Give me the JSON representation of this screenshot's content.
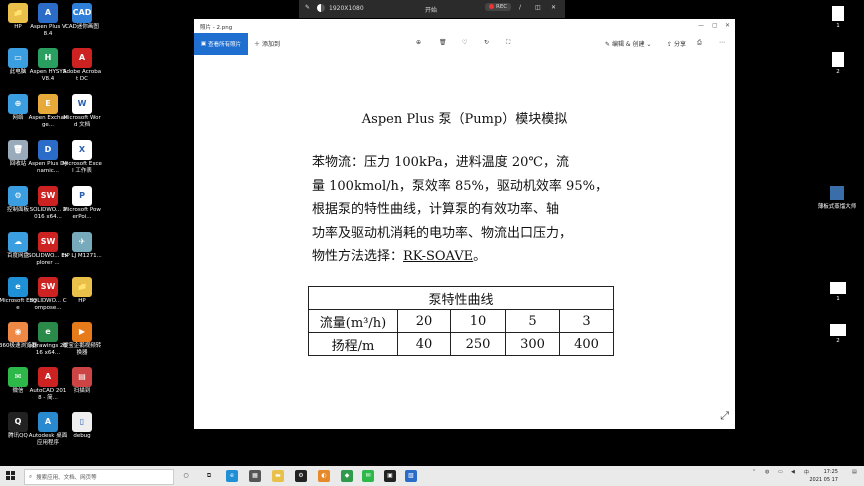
{
  "desktop_icons": [
    {
      "label": "HP",
      "glyph": "📁",
      "color": "#e8c04a",
      "icon": "folder-icon"
    },
    {
      "label": "Aspen Plus V8.4",
      "glyph": "A",
      "color": "#2a6cc8",
      "icon": "aspen-plus-icon"
    },
    {
      "label": "CAD迷你画图",
      "glyph": "CAD",
      "color": "#2f7fd8",
      "icon": "cad-icon"
    },
    {
      "label": "此电脑",
      "glyph": "▭",
      "color": "#3b9ee0",
      "icon": "computer-icon"
    },
    {
      "label": "Aspen HYSYS V8.4",
      "glyph": "H",
      "color": "#2aa060",
      "icon": "hysys-icon"
    },
    {
      "label": "Adobe Acrobat DC",
      "glyph": "A",
      "color": "#c22",
      "icon": "acrobat-icon"
    },
    {
      "label": "网络",
      "glyph": "⊕",
      "color": "#3b9ee0",
      "icon": "network-icon"
    },
    {
      "label": "Aspen Exchange...",
      "glyph": "E",
      "color": "#e6a93a",
      "icon": "aspen-exchanger-icon"
    },
    {
      "label": "Microsoft Word 文档",
      "glyph": "W",
      "color": "#fff",
      "icon": "word-doc-icon"
    },
    {
      "label": "回收站",
      "glyph": "🗑",
      "color": "#9ab",
      "icon": "recycle-bin-icon"
    },
    {
      "label": "Aspen Plus Dynamic...",
      "glyph": "D",
      "color": "#2a6cc8",
      "icon": "aspen-dynamics-icon"
    },
    {
      "label": "Microsoft Excel 工作表",
      "glyph": "X",
      "color": "#fff",
      "icon": "excel-doc-icon"
    },
    {
      "label": "控制面板",
      "glyph": "⚙",
      "color": "#3b9ee0",
      "icon": "control-panel-icon"
    },
    {
      "label": "SOLIDWO... 2016 x64...",
      "glyph": "SW",
      "color": "#c22",
      "icon": "solidworks-icon"
    },
    {
      "label": "Microsoft PowerPoi...",
      "glyph": "P",
      "color": "#fff",
      "icon": "powerpoint-doc-icon"
    },
    {
      "label": "百度网盘",
      "glyph": "☁",
      "color": "#3b9ee0",
      "icon": "baidu-netdisk-icon"
    },
    {
      "label": "SOLIDWO... Explorer ...",
      "glyph": "SW",
      "color": "#c22",
      "icon": "solidworks-explorer-icon"
    },
    {
      "label": "HP LJ M1271...",
      "glyph": "✈",
      "color": "#7ab",
      "icon": "printer-icon"
    },
    {
      "label": "Microsoft Edge",
      "glyph": "e",
      "color": "#1f8fd6",
      "icon": "edge-icon"
    },
    {
      "label": "SOLIDWO... Compose...",
      "glyph": "SW",
      "color": "#c22",
      "icon": "solidworks-composer-icon"
    },
    {
      "label": "HP",
      "glyph": "📁",
      "color": "#e8c04a",
      "icon": "folder-icon"
    },
    {
      "label": "360极速浏览器",
      "glyph": "◉",
      "color": "#e84",
      "icon": "360-browser-icon"
    },
    {
      "label": "eDrawings 2016 x64...",
      "glyph": "e",
      "color": "#2a8a4a",
      "icon": "edrawings-icon"
    },
    {
      "label": "暖宝企鹅视频转换器",
      "glyph": "▶",
      "color": "#e77a1a",
      "icon": "video-converter-icon"
    },
    {
      "label": "微信",
      "glyph": "✉",
      "color": "#2db84a",
      "icon": "wechat-icon"
    },
    {
      "label": "AutoCAD 2018 - 简...",
      "glyph": "A",
      "color": "#c22",
      "icon": "autocad-icon"
    },
    {
      "label": "扫描到",
      "glyph": "▤",
      "color": "#c44",
      "icon": "scan-icon"
    },
    {
      "label": "腾讯QQ",
      "glyph": "Q",
      "color": "#222",
      "icon": "qq-icon"
    },
    {
      "label": "Autodesk 桌面应用程序",
      "glyph": "A",
      "color": "#2a8ad0",
      "icon": "autodesk-icon"
    },
    {
      "label": "debug",
      "glyph": "▯",
      "color": "#eee",
      "icon": "file-icon"
    }
  ],
  "recording_bar": {
    "resolution": "1920X1080",
    "start_label": "开始",
    "rec_label": "REC"
  },
  "window": {
    "title": "照片 - 2.png",
    "all_photos_label": "查看所有照片",
    "add_to_label": "添加到",
    "edit_create_label": "编辑 & 创建",
    "share_label": "分享"
  },
  "document": {
    "title": "Aspen Plus 泵（Pump）模块模拟",
    "body_lines": [
      "苯物流：压力 100kPa，进料温度 20℃，流",
      "量 100kmol/h，泵效率 85%，驱动机效率 95%，",
      "根据泵的特性曲线，计算泵的有效功率、轴",
      "功率及驱动机消耗的电功率、物流出口压力，"
    ],
    "method_prefix": "物性方法选择：",
    "method_name": "RK-SOAVE",
    "method_suffix": "。",
    "table_caption": "泵特性曲线",
    "table_rows": [
      [
        "流量(m³/h)",
        "20",
        "10",
        "5",
        "3"
      ],
      [
        "扬程/m",
        "40",
        "250",
        "300",
        "400"
      ]
    ]
  },
  "right_icons": [
    {
      "label": "1"
    },
    {
      "label": "2"
    },
    {
      "label": "1"
    },
    {
      "label": "2"
    }
  ],
  "right_app": {
    "label": "薄板式蒸馏大师"
  },
  "taskbar": {
    "search_placeholder": "搜索应用、文档、网页等",
    "time": "17:25",
    "date": "2021 05 17"
  }
}
